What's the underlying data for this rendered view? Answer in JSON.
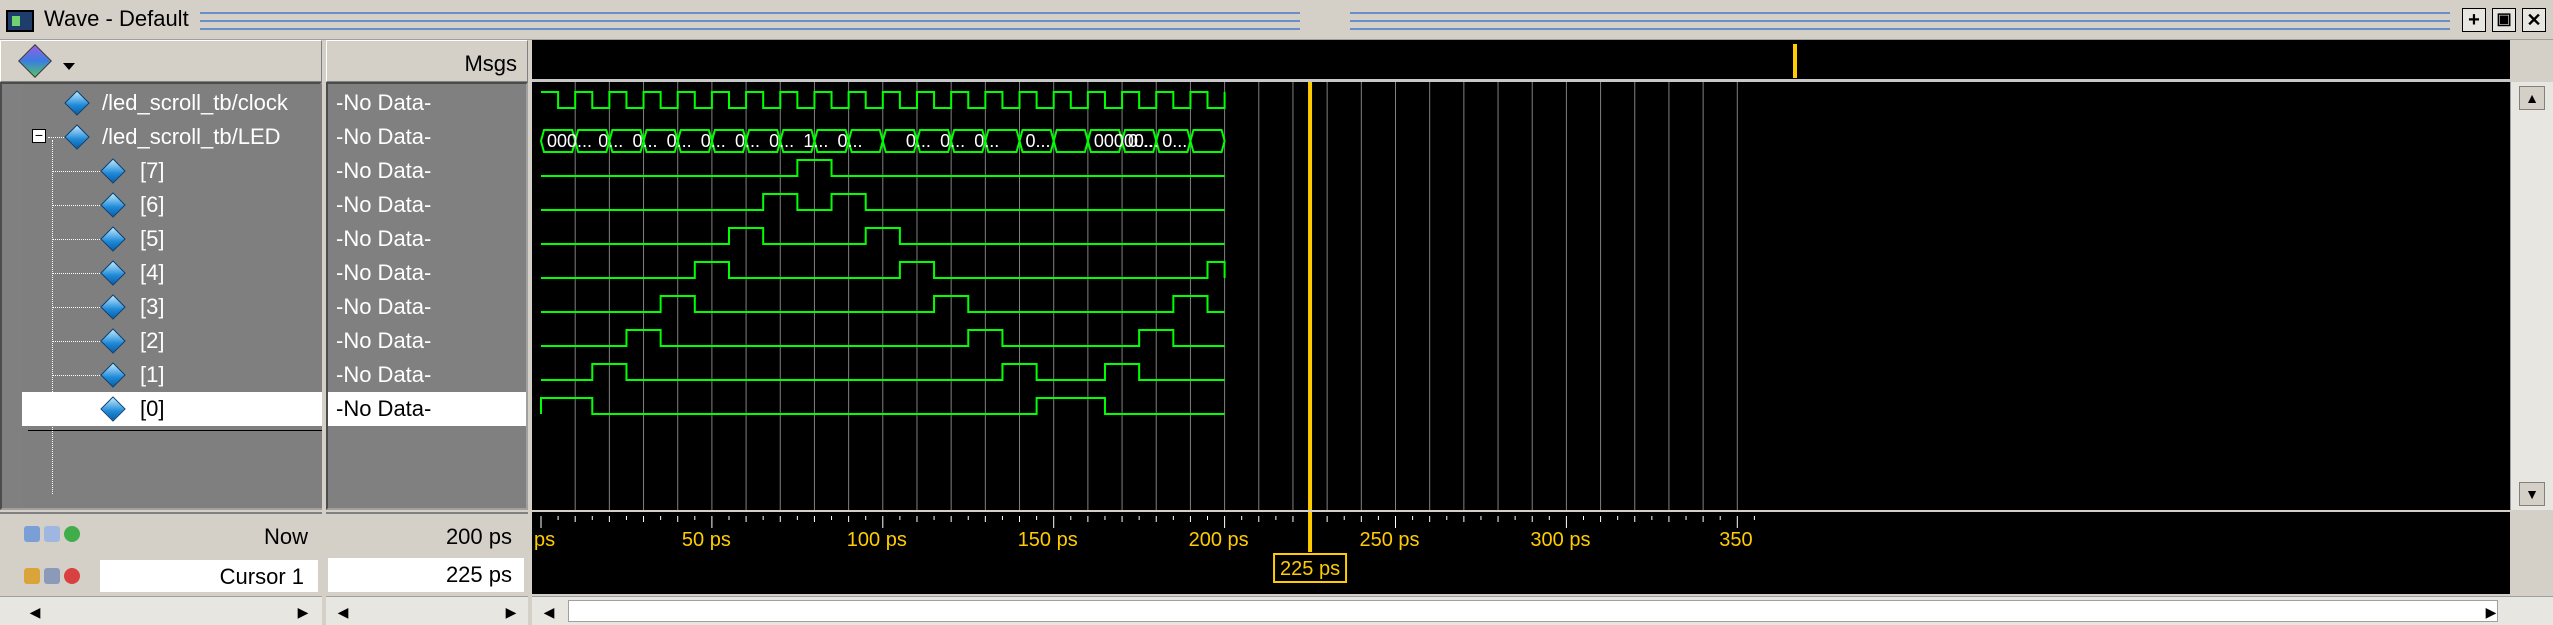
{
  "window": {
    "title": "Wave - Default"
  },
  "toolbar": {
    "msgs_header": "Msgs"
  },
  "signals": [
    {
      "name": "/led_scroll_tb/clock",
      "value": "-No Data-"
    },
    {
      "name": "/led_scroll_tb/LED",
      "value": "-No Data-"
    },
    {
      "name": "[7]",
      "value": "-No Data-"
    },
    {
      "name": "[6]",
      "value": "-No Data-"
    },
    {
      "name": "[5]",
      "value": "-No Data-"
    },
    {
      "name": "[4]",
      "value": "-No Data-"
    },
    {
      "name": "[3]",
      "value": "-No Data-"
    },
    {
      "name": "[2]",
      "value": "-No Data-"
    },
    {
      "name": "[1]",
      "value": "-No Data-"
    },
    {
      "name": "[0]",
      "value": "-No Data-"
    }
  ],
  "status": {
    "now_label": "Now",
    "now_value": "200 ps",
    "cursor_label": "Cursor 1",
    "cursor_value": "225 ps",
    "cursor_flag": "225 ps"
  },
  "timeline": {
    "unit": "ps",
    "tick_labels": [
      "ps",
      "50 ps",
      "100 ps",
      "150 ps",
      "200 ps",
      "250 ps",
      "300 ps",
      "350"
    ],
    "cursor_time": 225
  },
  "bus_labels": [
    "000...",
    "0...",
    "0...",
    "0...",
    "0...",
    "0...",
    "0...",
    "1...",
    "0...",
    "",
    "0...",
    "0...",
    "0...",
    "0...",
    "00000...",
    "0...",
    "0...",
    "0..."
  ],
  "colors": {
    "wave": "#00ff00",
    "cursor": "#ffcc00",
    "background": "#000000",
    "grid": "#808080"
  }
}
